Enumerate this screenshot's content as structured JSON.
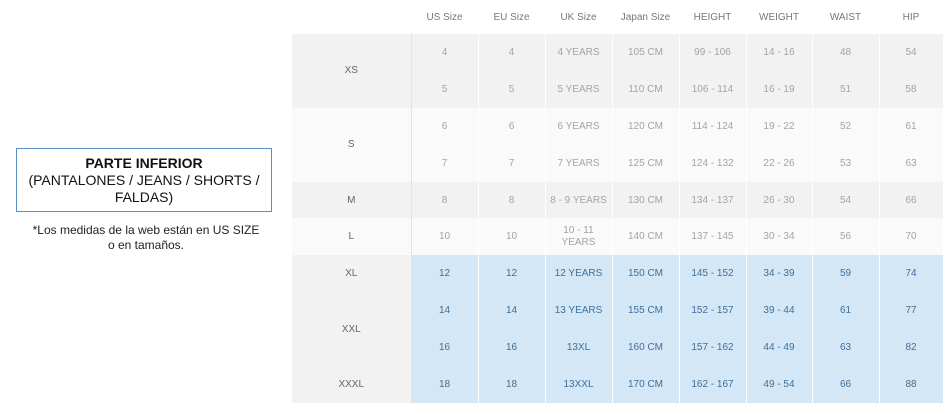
{
  "caption": {
    "title": "PARTE INFERIOR",
    "line2": "(PANTALONES / JEANS / SHORTS /",
    "line3": "FALDAS)"
  },
  "note": {
    "line1": "*Los medidas de la web están en US SIZE",
    "line2": "o en tamaños."
  },
  "table": {
    "headers": [
      "",
      "US Size",
      "EU Size",
      "UK Size",
      "Japan Size",
      "HEIGHT",
      "WEIGHT",
      "WAIST",
      "HIP"
    ],
    "groups": [
      {
        "size": "XS",
        "rows": [
          [
            "4",
            "4",
            "4 YEARS",
            "105 CM",
            "99 - 106",
            "14 - 16",
            "48",
            "54"
          ],
          [
            "5",
            "5",
            "5 YEARS",
            "110 CM",
            "106 - 114",
            "16 - 19",
            "51",
            "58"
          ]
        ]
      },
      {
        "size": "S",
        "rows": [
          [
            "6",
            "6",
            "6 YEARS",
            "120 CM",
            "114 - 124",
            "19 - 22",
            "52",
            "61"
          ],
          [
            "7",
            "7",
            "7 YEARS",
            "125 CM",
            "124 - 132",
            "22 - 26",
            "53",
            "63"
          ]
        ]
      },
      {
        "size": "M",
        "rows": [
          [
            "8",
            "8",
            "8 - 9 YEARS",
            "130 CM",
            "134 - 137",
            "26 - 30",
            "54",
            "66"
          ]
        ]
      },
      {
        "size": "L",
        "rows": [
          [
            "10",
            "10",
            "10 - 11\nYEARS",
            "140 CM",
            "137 - 145",
            "30 - 34",
            "56",
            "70"
          ]
        ]
      },
      {
        "size": "XL",
        "rows": [
          [
            "12",
            "12",
            "12 YEARS",
            "150 CM",
            "145 - 152",
            "34 - 39",
            "59",
            "74"
          ]
        ]
      },
      {
        "size": "XXL",
        "rows": [
          [
            "14",
            "14",
            "13 YEARS",
            "155 CM",
            "152 - 157",
            "39 - 44",
            "61",
            "77"
          ],
          [
            "16",
            "16",
            "13XL",
            "160 CM",
            "157 - 162",
            "44 - 49",
            "63",
            "82"
          ]
        ]
      },
      {
        "size": "XXXL",
        "rows": [
          [
            "18",
            "18",
            "13XXL",
            "170 CM",
            "162 - 167",
            "49 - 54",
            "66",
            "88"
          ]
        ]
      }
    ],
    "highlight_color": "#d4e7f7",
    "stripe_color": "#f2f2f2"
  }
}
